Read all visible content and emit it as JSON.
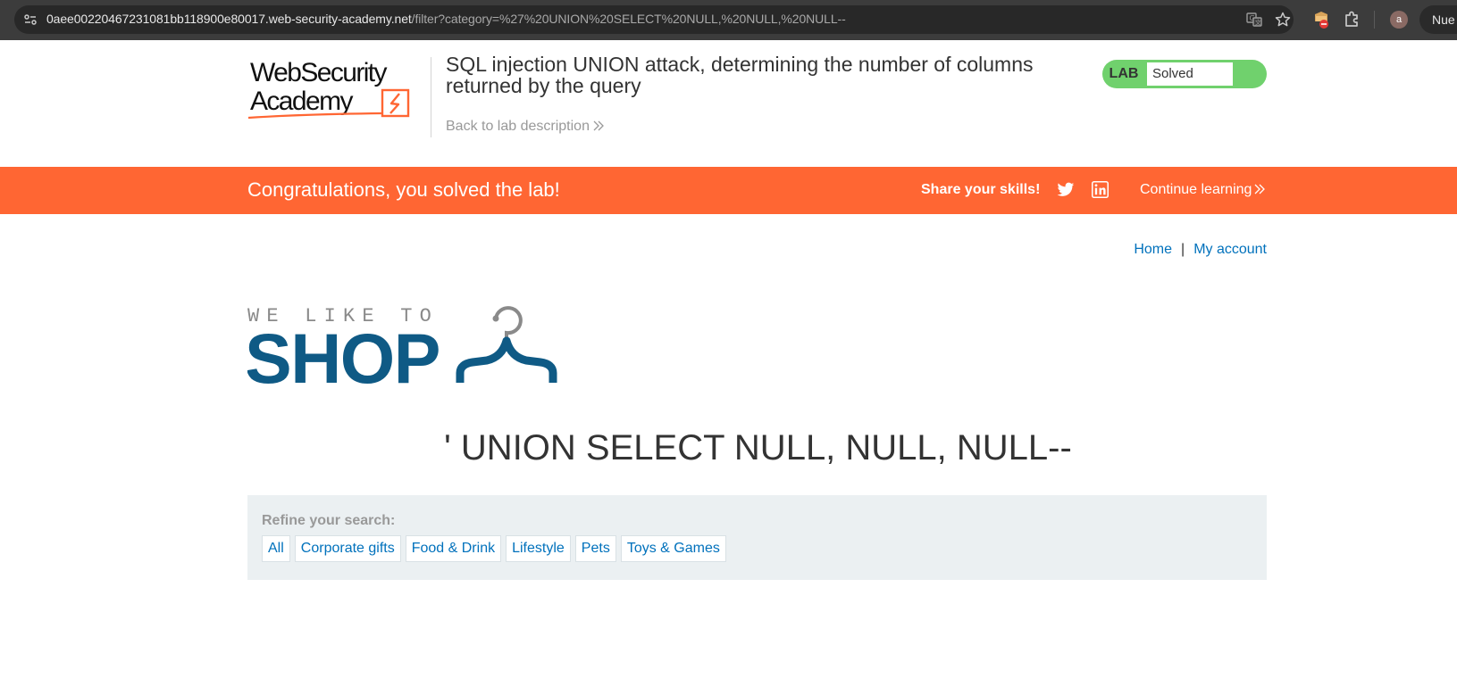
{
  "browser": {
    "url_host": "0aee00220467231081bb118900e80017.web-security-academy.net",
    "url_path": "/filter?category=%27%20UNION%20SELECT%20NULL,%20NULL,%20NULL--",
    "profile_initial": "a",
    "side_label": "Nue",
    "icons": [
      "site-info-icon",
      "translate-icon",
      "bookmark-star-icon",
      "extension-badge-icon",
      "extensions-puzzle-icon"
    ]
  },
  "header": {
    "logo_line1": "WebSecurity",
    "logo_line2": "Academy",
    "lab_title": "SQL injection UNION attack, determining the number of columns returned by the query",
    "back_link": "Back to lab description",
    "lab_tag": "LAB",
    "lab_status": "Solved",
    "status_color": "#70d16d"
  },
  "banner": {
    "message": "Congratulations, you solved the lab!",
    "share_label": "Share your skills!",
    "continue_label": "Continue learning",
    "color": "#ff6633"
  },
  "nav": {
    "home": "Home",
    "separator": "|",
    "account": "My account"
  },
  "shop_logo": {
    "tagline": "WE LIKE TO",
    "word": "SHOP"
  },
  "main": {
    "heading": "' UNION SELECT NULL, NULL, NULL--"
  },
  "filter": {
    "label": "Refine your search:",
    "categories": [
      "All",
      "Corporate gifts",
      "Food & Drink",
      "Lifestyle",
      "Pets",
      "Toys & Games"
    ]
  }
}
